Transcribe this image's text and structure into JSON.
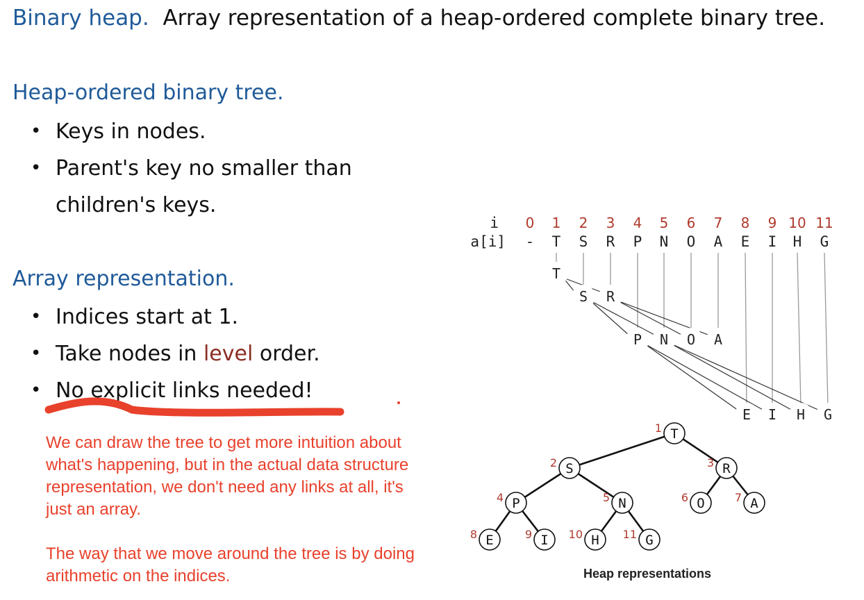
{
  "title": {
    "keyword": "Binary heap.",
    "text": "Array representation of a heap-ordered complete binary tree."
  },
  "section1": {
    "heading": "Heap-ordered binary tree.",
    "bullets": [
      "Keys in nodes.",
      "Parent's key no smaller than",
      "children's keys."
    ]
  },
  "section2": {
    "heading": "Array representation.",
    "bullet1": "Indices start at 1.",
    "bullet2_pre": "Take nodes in ",
    "bullet2_hl": "level",
    "bullet2_post": " order.",
    "bullet3": "No explicit links needed!"
  },
  "annotation": {
    "para1": "We can draw the tree to get more intuition about what's happening, but in the actual data structure representation, we don't need any links at all, it's just an array.",
    "para2": "The way that we move around the tree is by doing arithmetic on the indices."
  },
  "array": {
    "index_label": "i",
    "value_label": "a[i]",
    "indices": [
      "0",
      "1",
      "2",
      "3",
      "4",
      "5",
      "6",
      "7",
      "8",
      "9",
      "10",
      "11"
    ],
    "values": [
      "-",
      "T",
      "S",
      "R",
      "P",
      "N",
      "O",
      "A",
      "E",
      "I",
      "H",
      "G"
    ]
  },
  "caption": "Heap representations",
  "colors": {
    "accent": "#1f5a99",
    "index_red": "#b03a2e",
    "annotation": "#e8412c",
    "highlight": "#8b2d23"
  }
}
